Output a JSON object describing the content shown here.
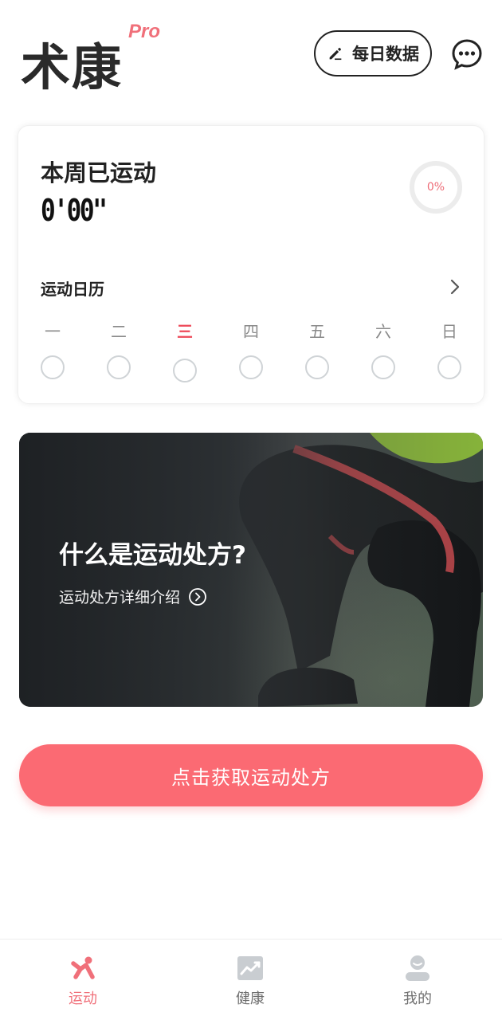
{
  "header": {
    "logo_text": "术康",
    "logo_badge": "Pro",
    "daily_data_label": "每日数据"
  },
  "weekly": {
    "title": "本周已运动",
    "time": "0'00\"",
    "progress_text": "0%",
    "progress_percent": 0,
    "calendar_title": "运动日历",
    "days": [
      {
        "label": "一",
        "today": false
      },
      {
        "label": "二",
        "today": false
      },
      {
        "label": "三",
        "today": true
      },
      {
        "label": "四",
        "today": false
      },
      {
        "label": "五",
        "today": false
      },
      {
        "label": "六",
        "today": false
      },
      {
        "label": "日",
        "today": false
      }
    ]
  },
  "banner": {
    "title": "什么是运动处方?",
    "subtitle": "运动处方详细介绍"
  },
  "cta": {
    "label": "点击获取运动处方"
  },
  "tabbar": {
    "tabs": [
      {
        "label": "运动",
        "icon": "exercise-icon",
        "active": true
      },
      {
        "label": "健康",
        "icon": "health-chart-icon",
        "active": false
      },
      {
        "label": "我的",
        "icon": "profile-icon",
        "active": false
      }
    ]
  },
  "colors": {
    "accent": "#fb6a73",
    "today_red": "#ee4a59",
    "text_dark": "#222222"
  }
}
